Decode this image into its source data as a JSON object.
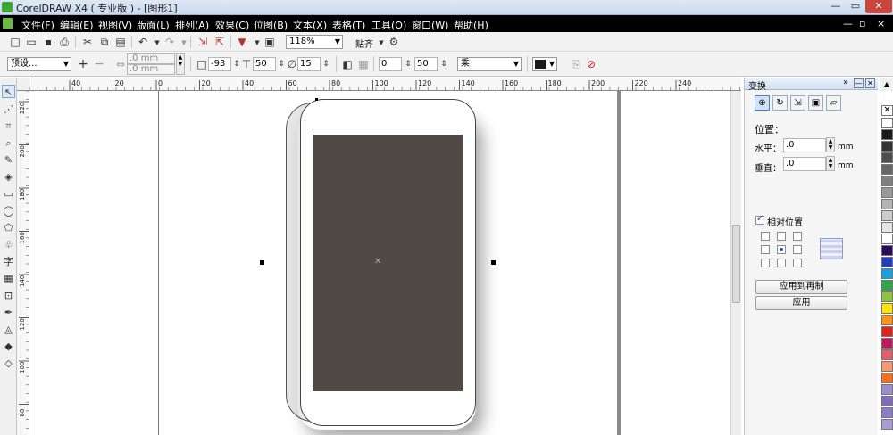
{
  "window": {
    "title": "CorelDRAW X4 ( 专业版 ) - [图形1]",
    "controls": [
      "—",
      "▭",
      "✕"
    ]
  },
  "menu": {
    "items": [
      "文件(F)",
      "编辑(E)",
      "视图(V)",
      "版面(L)",
      "排列(A)",
      "效果(C)",
      "位图(B)",
      "文本(X)",
      "表格(T)",
      "工具(O)",
      "窗口(W)",
      "帮助(H)"
    ],
    "right_controls": [
      "—",
      "▫",
      "×"
    ]
  },
  "toolbar1": {
    "zoom_value": "118%",
    "snap_label": "贴齐"
  },
  "toolbar2": {
    "preset_value": "预设...",
    "width_value": ".0 mm",
    "height_value": ".0 mm",
    "x_value": "-93",
    "y_value": "50",
    "angle_value": "15",
    "field_a_value": "0",
    "field_b_value": "50",
    "mode_value": "乘",
    "fill_color": "#1a1a1a"
  },
  "ruler": {
    "top_labels": [
      "40",
      "20",
      "0",
      "20",
      "40",
      "60",
      "80",
      "100",
      "120",
      "140",
      "160",
      "180",
      "200",
      "220",
      "240"
    ],
    "left_labels": [
      "220",
      "200",
      "180",
      "160",
      "140",
      "120",
      "100",
      "80"
    ]
  },
  "docker": {
    "title": "变换",
    "section_position": "位置：",
    "horizontal_label": "水平：",
    "horizontal_value": ".0",
    "vertical_label": "垂直：",
    "vertical_value": ".0",
    "unit": "mm",
    "relative_position_label": "相对位置",
    "relative_position_checked": true,
    "apply_to_duplicate_label": "应用到再制",
    "apply_label": "应用"
  },
  "drawing": {
    "screen_color": "#4f4a46",
    "body_color": "#ffffff",
    "side_color": "#e6e6e6"
  },
  "palette": {
    "colors": [
      "#ffffff",
      "#1a1a1a",
      "#333333",
      "#4d4d4d",
      "#666666",
      "#808080",
      "#999999",
      "#b3b3b3",
      "#cccccc",
      "#e6e6e6",
      "#ffffff",
      "#2b0a5e",
      "#1f3fbf",
      "#19a0e0",
      "#2aa84a",
      "#8cc63f",
      "#ffe600",
      "#f7941d",
      "#e2231a",
      "#c2185b",
      "#e35d6a",
      "#f39a71",
      "#f36f21",
      "#9b8fd1",
      "#7e6bbf",
      "#8a7cc8",
      "#a89bd8"
    ]
  }
}
